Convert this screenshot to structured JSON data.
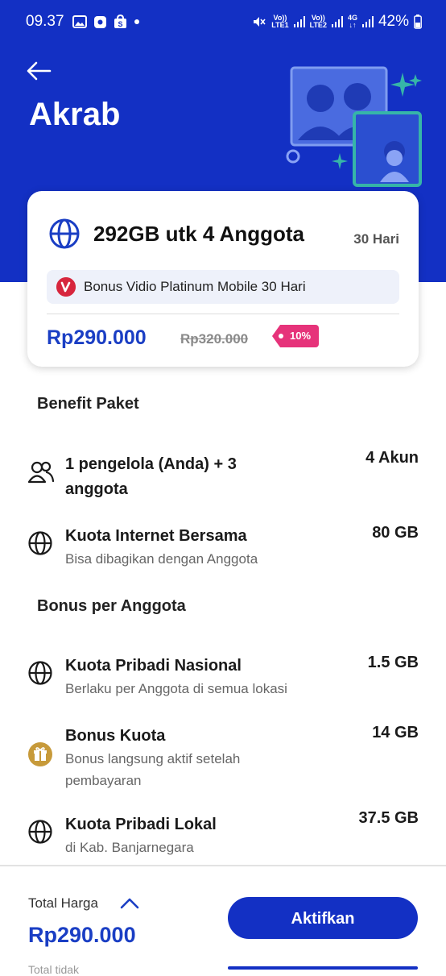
{
  "status_bar": {
    "time": "09.37",
    "battery": "42%",
    "sim1": "LTE1",
    "sim2": "LTE2",
    "network": "4G"
  },
  "header": {
    "title": "Akrab"
  },
  "package": {
    "name": "292GB utk 4 Anggota",
    "duration": "30 Hari",
    "bonus": "Bonus Vidio Platinum Mobile 30 Hari",
    "price": "Rp290.000",
    "original_price": "Rp320.000",
    "discount": "10%"
  },
  "benefit_section": {
    "title": "Benefit Paket",
    "items": [
      {
        "title": "1 pengelola (Anda) + 3 anggota",
        "subtitle": "",
        "value": "4 Akun",
        "icon": "users-icon"
      },
      {
        "title": "Kuota Internet Bersama",
        "subtitle": "Bisa dibagikan dengan Anggota",
        "value": "80 GB",
        "icon": "globe-icon"
      }
    ]
  },
  "bonus_section": {
    "title": "Bonus per Anggota",
    "items": [
      {
        "title": "Kuota Pribadi Nasional",
        "subtitle": "Berlaku per Anggota di semua lokasi",
        "value": "1.5 GB",
        "icon": "globe-icon"
      },
      {
        "title": "Bonus Kuota",
        "subtitle": "Bonus langsung aktif setelah pembayaran",
        "value": "14 GB",
        "icon": "gift-icon"
      },
      {
        "title": "Kuota Pribadi Lokal",
        "subtitle": "di Kab. Banjarnegara",
        "value": "37.5 GB",
        "icon": "globe-icon"
      }
    ]
  },
  "footer": {
    "total_label": "Total Harga",
    "total_price": "Rp290.000",
    "button_label": "Aktifkan",
    "cut_text": "Total tidak"
  },
  "colors": {
    "primary": "#1330c4",
    "price": "#1a3ec4",
    "discount": "#e6337a",
    "gift": "#c79a3a"
  }
}
